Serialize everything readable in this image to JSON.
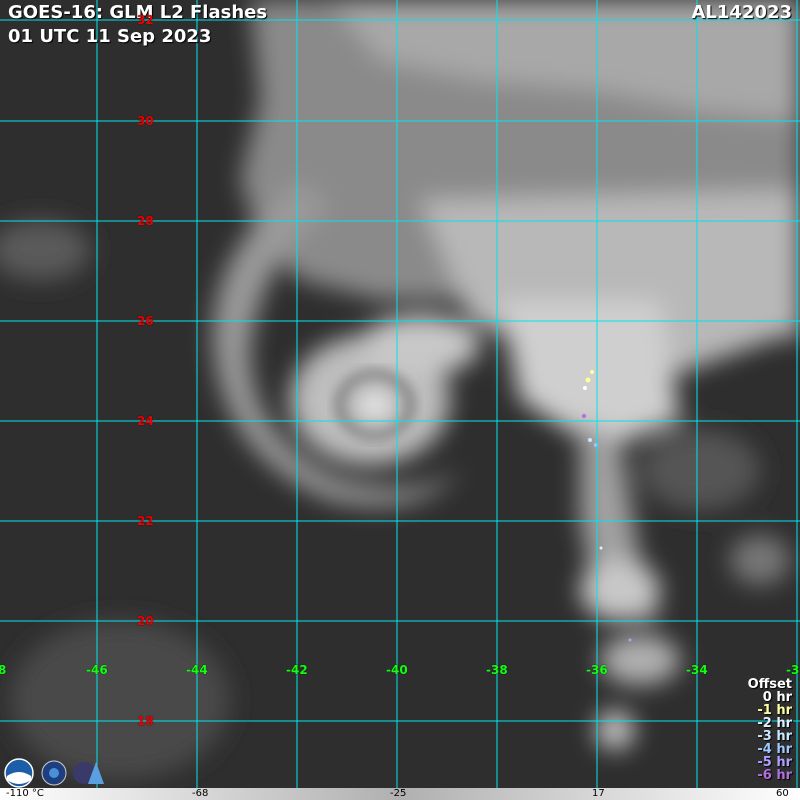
{
  "header": {
    "title": "GOES-16: GLM L2 Flashes",
    "datetime": "01 UTC 11 Sep 2023",
    "storm_id": "AL142023"
  },
  "grid": {
    "lat_labels": [
      "32",
      "30",
      "28",
      "26",
      "24",
      "22",
      "20",
      "18"
    ],
    "lon_labels": [
      "8",
      "-46",
      "-44",
      "-42",
      "-40",
      "-38",
      "-36",
      "-34",
      "-3"
    ],
    "line_color": "#00e5ee"
  },
  "legend": {
    "title": "Offset",
    "items": [
      {
        "label": "0 hr",
        "color": "#ffffff"
      },
      {
        "label": "-1 hr",
        "color": "#ffffa0"
      },
      {
        "label": "-2 hr",
        "color": "#e0f0ff"
      },
      {
        "label": "-3 hr",
        "color": "#c8e8ff"
      },
      {
        "label": "-4 hr",
        "color": "#a0c8ff"
      },
      {
        "label": "-5 hr",
        "color": "#b0a0ff"
      },
      {
        "label": "-6 hr",
        "color": "#b070e0"
      }
    ]
  },
  "colorbar": {
    "labels": [
      "-110 °C",
      "-68",
      "-25",
      "17",
      "60"
    ]
  },
  "logos": [
    "noaa-logo",
    "nesdis-logo",
    "cira-logo"
  ]
}
